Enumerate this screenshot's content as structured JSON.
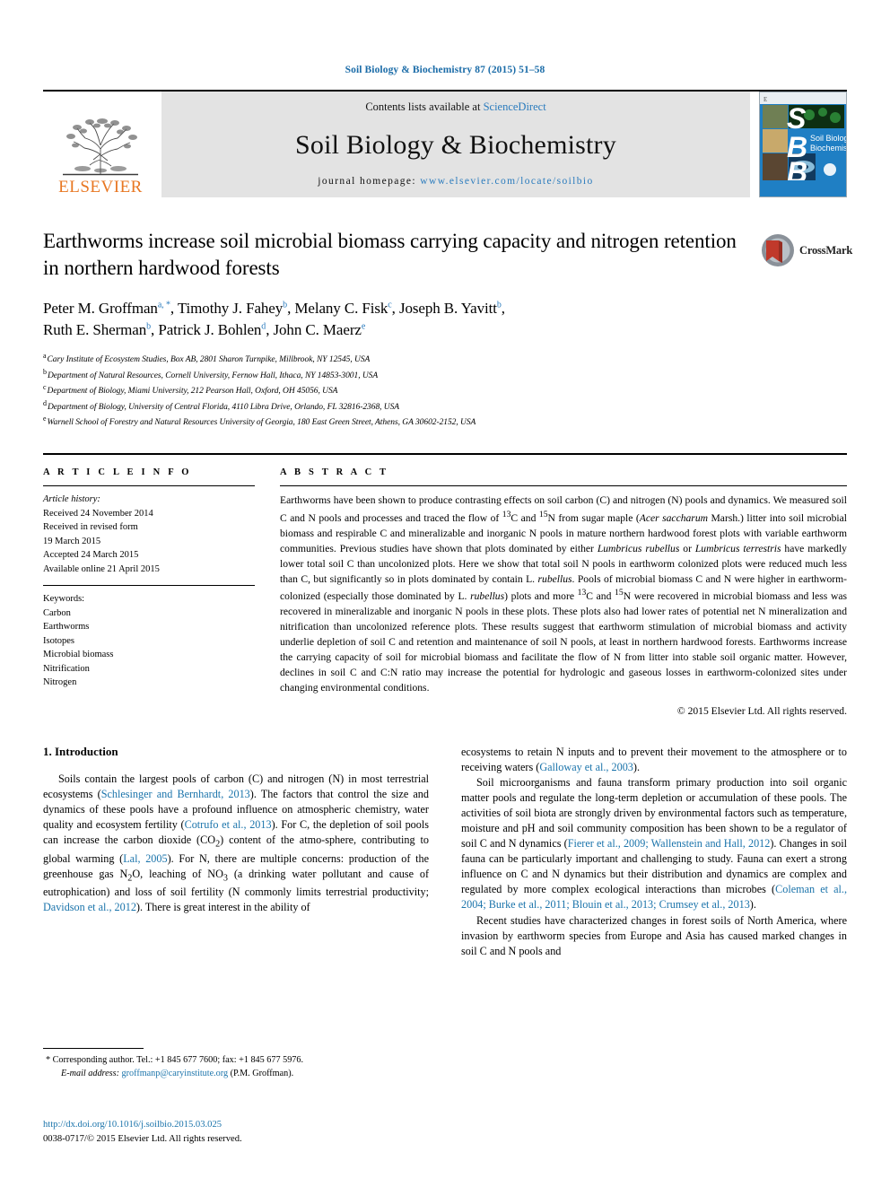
{
  "running_head": "Soil Biology & Biochemistry 87 (2015) 51–58",
  "masthead": {
    "publisher_logo_text": "ELSEVIER",
    "contents_prefix": "Contents lists available at ",
    "contents_link": "ScienceDirect",
    "journal_name": "Soil Biology & Biochemistry",
    "homepage_prefix": "journal homepage: ",
    "homepage_url": "www.elsevier.com/locate/soilbio",
    "cover_letters": [
      "S",
      "B",
      "B"
    ],
    "cover_title_line1": "Soil Biology &",
    "cover_title_line2": "Biochemistry"
  },
  "crossmark": {
    "label": "CrossMark"
  },
  "title": "Earthworms increase soil microbial biomass carrying capacity and nitrogen retention in northern hardwood forests",
  "authors_line1": "Peter M. Groffman",
  "authors": [
    {
      "name": "Peter M. Groffman",
      "marks": "a, *"
    },
    {
      "name": "Timothy J. Fahey",
      "marks": "b"
    },
    {
      "name": "Melany C. Fisk",
      "marks": "c"
    },
    {
      "name": "Joseph B. Yavitt",
      "marks": "b"
    },
    {
      "name": "Ruth E. Sherman",
      "marks": "b"
    },
    {
      "name": "Patrick J. Bohlen",
      "marks": "d"
    },
    {
      "name": "John C. Maerz",
      "marks": "e"
    }
  ],
  "affiliations": [
    {
      "mark": "a",
      "text": "Cary Institute of Ecosystem Studies, Box AB, 2801 Sharon Turnpike, Millbrook, NY 12545, USA"
    },
    {
      "mark": "b",
      "text": "Department of Natural Resources, Cornell University, Fernow Hall, Ithaca, NY 14853-3001, USA"
    },
    {
      "mark": "c",
      "text": "Department of Biology, Miami University, 212 Pearson Hall, Oxford, OH 45056, USA"
    },
    {
      "mark": "d",
      "text": "Department of Biology, University of Central Florida, 4110 Libra Drive, Orlando, FL 32816-2368, USA"
    },
    {
      "mark": "e",
      "text": "Warnell School of Forestry and Natural Resources University of Georgia, 180 East Green Street, Athens, GA 30602-2152, USA"
    }
  ],
  "article_info": {
    "heading": "A R T I C L E   I N F O",
    "history_label": "Article history:",
    "history": [
      "Received 24 November 2014",
      "Received in revised form",
      "19 March 2015",
      "Accepted 24 March 2015",
      "Available online 21 April 2015"
    ],
    "keywords_label": "Keywords:",
    "keywords": [
      "Carbon",
      "Earthworms",
      "Isotopes",
      "Microbial biomass",
      "Nitrification",
      "Nitrogen"
    ]
  },
  "abstract": {
    "heading": "A B S T R A C T",
    "text_part1": "Earthworms have been shown to produce contrasting effects on soil carbon (C) and nitrogen (N) pools and dynamics. We measured soil C and N pools and processes and traced the flow of ",
    "sup_13": "13",
    "c_and": "C and ",
    "sup_15": "15",
    "n_from": "N from sugar maple (",
    "italic_species1": "Acer saccharum",
    "text_part2": " Marsh.) litter into soil microbial biomass and respirable C and mineralizable and inorganic N pools in mature northern hardwood forest plots with variable earthworm communities. Previous studies have shown that plots dominated by either ",
    "italic_species2": "Lumbricus rubellus",
    "text_part3": " or ",
    "italic_species3": "Lumbricus terrestris",
    "text_part4": " have markedly lower total soil C than uncolonized plots. Here we show that total soil N pools in earthworm colonized plots were reduced much less than C, but significantly so in plots dominated by contain L. ",
    "italic_species4": "rubellus",
    "text_part5": ". Pools of microbial biomass C and N were higher in earthworm-colonized (especially those dominated by L. ",
    "italic_species5": "rubellus",
    "text_part6": ") plots and more ",
    "text_part7": "C and ",
    "text_part8": "N were recovered in microbial biomass and less was recovered in mineralizable and inorganic N pools in these plots. These plots also had lower rates of potential net N mineralization and nitrification than uncolonized reference plots. These results suggest that earthworm stimulation of microbial biomass and activity underlie depletion of soil C and retention and maintenance of soil N pools, at least in northern hardwood forests. Earthworms increase the carrying capacity of soil for microbial biomass and facilitate the flow of N from litter into stable soil organic matter. However, declines in soil C and C:N ratio may increase the potential for hydrologic and gaseous losses in earthworm-colonized sites under changing environmental conditions.",
    "copyright": "© 2015 Elsevier Ltd. All rights reserved."
  },
  "introduction": {
    "heading": "1.  Introduction",
    "left_p1_a": "Soils contain the largest pools of carbon (C) and nitrogen (N) in most terrestrial ecosystems (",
    "left_ref1": "Schlesinger and Bernhardt, 2013",
    "left_p1_b": "). The factors that control the size and dynamics of these pools have a profound influence on atmospheric chemistry, water quality and ecosystem fertility (",
    "left_ref2": "Cotrufo et al., 2013",
    "left_p1_c": "). For C, the depletion of soil pools can increase the carbon dioxide (CO",
    "co2_sub": "2",
    "left_p1_d": ") content of the atmo-sphere, contributing to global warming (",
    "left_ref3": "Lal, 2005",
    "left_p1_e": "). For N, there are multiple concerns: production of the greenhouse gas N",
    "n2o_sub": "2",
    "left_p1_f": "O, leaching of NO",
    "no3_sub": "3",
    "left_p1_g": " (a drinking water pollutant and cause of eutrophication) and loss of soil fertility (N commonly limits terrestrial productivity; ",
    "left_ref4": "Davidson et al., 2012",
    "left_p1_h": "). There is great interest in the ability of",
    "right_p1_a": "ecosystems to retain N inputs and to prevent their movement to the atmosphere or to receiving waters (",
    "right_ref1": "Galloway et al., 2003",
    "right_p1_b": ").",
    "right_p2_a": "Soil microorganisms and fauna transform primary production into soil organic matter pools and regulate the long-term depletion or accumulation of these pools. The activities of soil biota are strongly driven by environmental factors such as temperature, moisture and pH and soil community composition has been shown to be a regulator of soil C and N dynamics (",
    "right_ref2": "Fierer et al., 2009; Wallenstein and Hall, 2012",
    "right_p2_b": "). Changes in soil fauna can be particularly important and challenging to study. Fauna can exert a strong influence on C and N dynamics but their distribution and dynamics are complex and regulated by more complex ecological interactions than microbes (",
    "right_ref3": "Coleman et al., 2004; Burke et al., 2011; Blouin et al., 2013; Crumsey et al., 2013",
    "right_p2_b2": ").",
    "right_p3": "Recent studies have characterized changes in forest soils of North America, where invasion by earthworm species from Europe and Asia has caused marked changes in soil C and N pools and"
  },
  "footnote": {
    "corresponding": "* Corresponding author. Tel.: +1 845 677 7600; fax: +1 845 677 5976.",
    "email_label": "E-mail address:",
    "email": "groffmanp@caryinstitute.org",
    "email_suffix": "(P.M. Groffman)."
  },
  "doi_block": {
    "doi_url": "http://dx.doi.org/10.1016/j.soilbio.2015.03.025",
    "issn_line": "0038-0717/© 2015 Elsevier Ltd. All rights reserved."
  },
  "colors": {
    "link_blue": "#1b74ab",
    "elsevier_orange": "#E87722",
    "cover_blue": "#1f7fc4",
    "band_gray": "#e3e3e3"
  }
}
